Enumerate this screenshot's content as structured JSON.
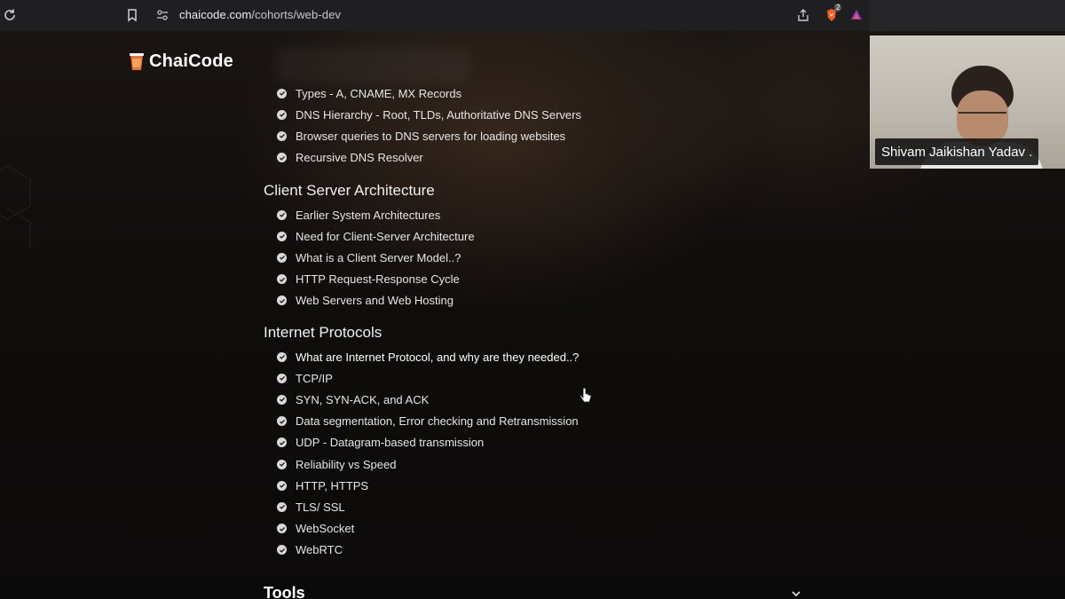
{
  "browser": {
    "url_host": "chaicode.com",
    "url_path": "/cohorts/web-dev",
    "shield_count": "2"
  },
  "brand": {
    "name": "ChaiCode"
  },
  "sections": {
    "dns_items": [
      "Types - A, CNAME, MX Records",
      "DNS Hierarchy - Root, TLDs, Authoritative DNS Servers",
      "Browser queries to DNS servers for loading websites",
      "Recursive DNS Resolver"
    ],
    "client_server": {
      "title": "Client Server Architecture",
      "items": [
        "Earlier System Architectures",
        "Need for Client-Server Architecture",
        "What is a Client Server Model..?",
        "HTTP Request-Response Cycle",
        "Web Servers and Web Hosting"
      ]
    },
    "protocols": {
      "title": "Internet Protocols",
      "items": [
        "What are Internet Protocol, and why are they needed..?",
        "TCP/IP",
        "SYN, SYN-ACK, and ACK",
        "Data segmentation, Error checking and Retransmission",
        "UDP - Datagram-based transmission",
        "Reliability vs Speed",
        "HTTP, HTTPS",
        "TLS/ SSL",
        "WebSocket",
        "WebRTC"
      ]
    },
    "tools": {
      "title": "Tools"
    }
  },
  "webcam": {
    "name": "Shivam Jaikishan Yadav ."
  },
  "icons": {
    "reload": "reload-icon",
    "bookmark": "bookmark-icon",
    "site_settings": "site-settings-icon",
    "share": "share-icon",
    "brave": "brave-shield-icon",
    "rewards": "brave-rewards-icon",
    "check": "check-circle-icon",
    "chevron": "chevron-down-icon",
    "cursor": "hand-pointer-icon"
  },
  "colors": {
    "accent_orange": "#e8742c",
    "text": "#e6e6e6",
    "background": "#0c0a09"
  }
}
